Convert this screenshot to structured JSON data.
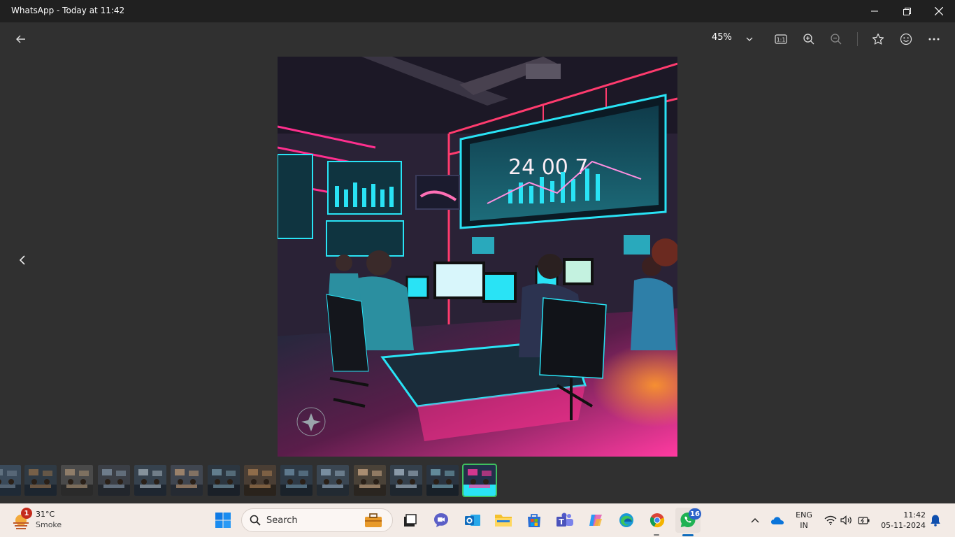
{
  "window": {
    "title": "WhatsApp - Today at 11:42"
  },
  "toolbar": {
    "zoom": "45%"
  },
  "photo": {
    "screen_text": "24 00 7",
    "colors": {
      "neon_pink": "#ff2f8e",
      "neon_cyan": "#29e3f5",
      "wall": "#2a2236"
    }
  },
  "filmstrip": {
    "count": 14,
    "active_index": 13,
    "accent": "#3fbf5e"
  },
  "taskbar": {
    "weather": {
      "temp": "31°C",
      "condition": "Smoke",
      "alert_count": "1"
    },
    "search_label": "Search",
    "whatsapp_badge": "16",
    "language": {
      "line1": "ENG",
      "line2": "IN"
    },
    "clock": {
      "time": "11:42",
      "date": "05-11-2024"
    }
  }
}
